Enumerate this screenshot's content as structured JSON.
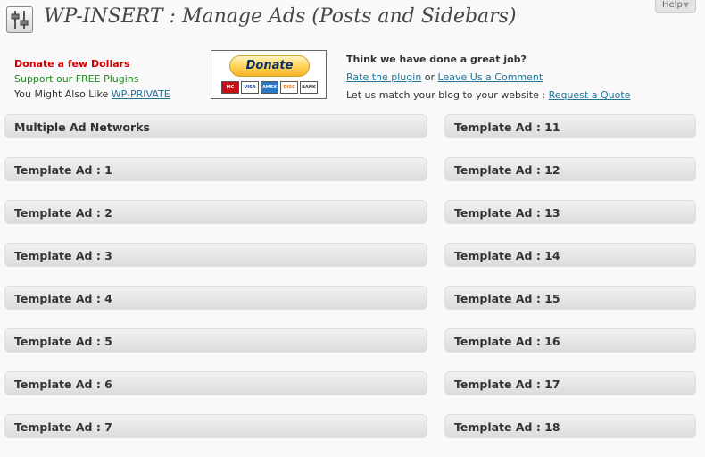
{
  "help": {
    "label": "Help",
    "arrow": "▼"
  },
  "header": {
    "title": "WP-INSERT : Manage Ads (Posts and Sidebars)"
  },
  "promo_left": {
    "donate": "Donate a few Dollars",
    "support": "Support our FREE Plugins",
    "also_prefix": "You Might Also Like ",
    "also_link": "WP-PRIVATE"
  },
  "donate_box": {
    "button_label": "Donate",
    "cards": [
      "MC",
      "VISA",
      "AMEX",
      "DISC",
      "BANK"
    ]
  },
  "promo_right": {
    "heading": "Think we have done a great job?",
    "rate_link": "Rate the plugin",
    "or_text": " or ",
    "comment_link": "Leave Us a Comment",
    "match_prefix": "Let us match your blog to your website : ",
    "quote_link": "Request a Quote"
  },
  "left_column": [
    "Multiple Ad Networks",
    "Template Ad : 1",
    "Template Ad : 2",
    "Template Ad : 3",
    "Template Ad : 4",
    "Template Ad : 5",
    "Template Ad : 6",
    "Template Ad : 7"
  ],
  "right_column": [
    "Template Ad : 11",
    "Template Ad : 12",
    "Template Ad : 13",
    "Template Ad : 14",
    "Template Ad : 15",
    "Template Ad : 16",
    "Template Ad : 17",
    "Template Ad : 18"
  ]
}
